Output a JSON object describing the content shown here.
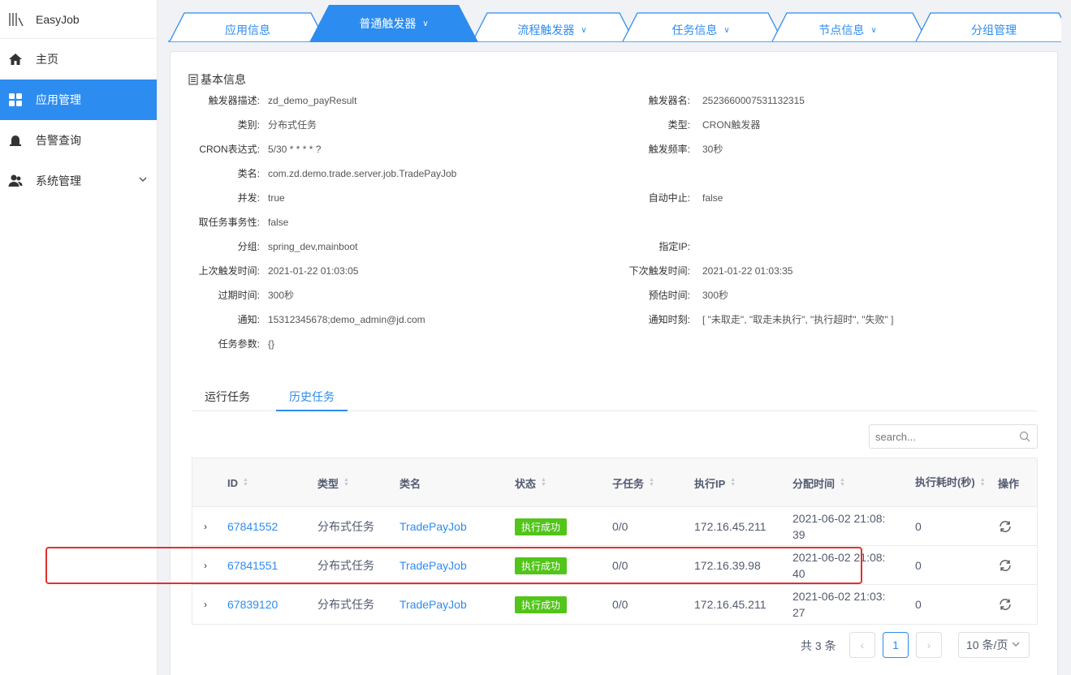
{
  "app": {
    "name": "EasyJob"
  },
  "sidebar": {
    "items": [
      {
        "label": "主页",
        "icon": "home-icon"
      },
      {
        "label": "应用管理",
        "icon": "grid-icon",
        "active": true
      },
      {
        "label": "告警查询",
        "icon": "alarm-icon"
      },
      {
        "label": "系统管理",
        "icon": "users-icon",
        "expandable": true
      }
    ]
  },
  "top_tabs": [
    {
      "label": "应用信息",
      "dropdown": false
    },
    {
      "label": "普通触发器",
      "dropdown": true,
      "active": true
    },
    {
      "label": "流程触发器",
      "dropdown": true
    },
    {
      "label": "任务信息",
      "dropdown": true
    },
    {
      "label": "节点信息",
      "dropdown": true
    },
    {
      "label": "分组管理",
      "dropdown": false
    }
  ],
  "basic_info": {
    "title": "基本信息",
    "left": [
      {
        "label": "触发器描述:",
        "value": "zd_demo_payResult"
      },
      {
        "label": "类别:",
        "value": "分布式任务"
      },
      {
        "label": "CRON表达式:",
        "value": "5/30 * * * * ?"
      },
      {
        "label": "类名:",
        "value": "com.zd.demo.trade.server.job.TradePayJob"
      },
      {
        "label": "并发:",
        "value": "true"
      },
      {
        "label": "取任务事务性:",
        "value": "false"
      },
      {
        "label": "分组:",
        "value": "spring_dev,mainboot"
      },
      {
        "label": "上次触发时间:",
        "value": "2021-01-22 01:03:05"
      },
      {
        "label": "过期时间:",
        "value": "300秒"
      },
      {
        "label": "通知:",
        "value": "15312345678;demo_admin@jd.com"
      },
      {
        "label": "任务参数:",
        "value": "{}"
      }
    ],
    "right": [
      {
        "label": "触发器名:",
        "value": "2523660007531132315"
      },
      {
        "label": "类型:",
        "value": "CRON触发器"
      },
      {
        "label": "触发频率:",
        "value": "30秒"
      },
      {
        "label": "",
        "value": ""
      },
      {
        "label": "自动中止:",
        "value": "false"
      },
      {
        "label": "",
        "value": ""
      },
      {
        "label": "指定IP:",
        "value": ""
      },
      {
        "label": "下次触发时间:",
        "value": "2021-01-22 01:03:35"
      },
      {
        "label": "预估时间:",
        "value": "300秒"
      },
      {
        "label": "通知时刻:",
        "value": "[ \"未取走\", \"取走未执行\", \"执行超时\", \"失败\" ]"
      }
    ]
  },
  "sub_tabs": [
    {
      "label": "运行任务"
    },
    {
      "label": "历史任务",
      "active": true
    }
  ],
  "search": {
    "placeholder": "search..."
  },
  "table": {
    "columns": [
      "ID",
      "类型",
      "类名",
      "状态",
      "子任务",
      "执行IP",
      "分配时间",
      "执行耗时(秒)",
      "操作"
    ],
    "rows": [
      {
        "id": "67841552",
        "type": "分布式任务",
        "class": "TradePayJob",
        "status": "执行成功",
        "sub": "0/0",
        "ip": "172.16.45.211",
        "time_a": "2021-06-02 21:08:",
        "time_b": "39",
        "cost": "0"
      },
      {
        "id": "67841551",
        "type": "分布式任务",
        "class": "TradePayJob",
        "status": "执行成功",
        "sub": "0/0",
        "ip": "172.16.39.98",
        "time_a": "2021-06-02 21:08:",
        "time_b": "40",
        "cost": "0"
      },
      {
        "id": "67839120",
        "type": "分布式任务",
        "class": "TradePayJob",
        "status": "执行成功",
        "sub": "0/0",
        "ip": "172.16.45.211",
        "time_a": "2021-06-02 21:03:",
        "time_b": "27",
        "cost": "0"
      }
    ]
  },
  "pagination": {
    "total_text": "共 3 条",
    "current_page": "1",
    "prev": "‹",
    "next": "›",
    "page_size": "10 条/页"
  },
  "colors": {
    "accent": "#2d8cf0",
    "success": "#52c41a",
    "highlight": "#e0312b"
  }
}
